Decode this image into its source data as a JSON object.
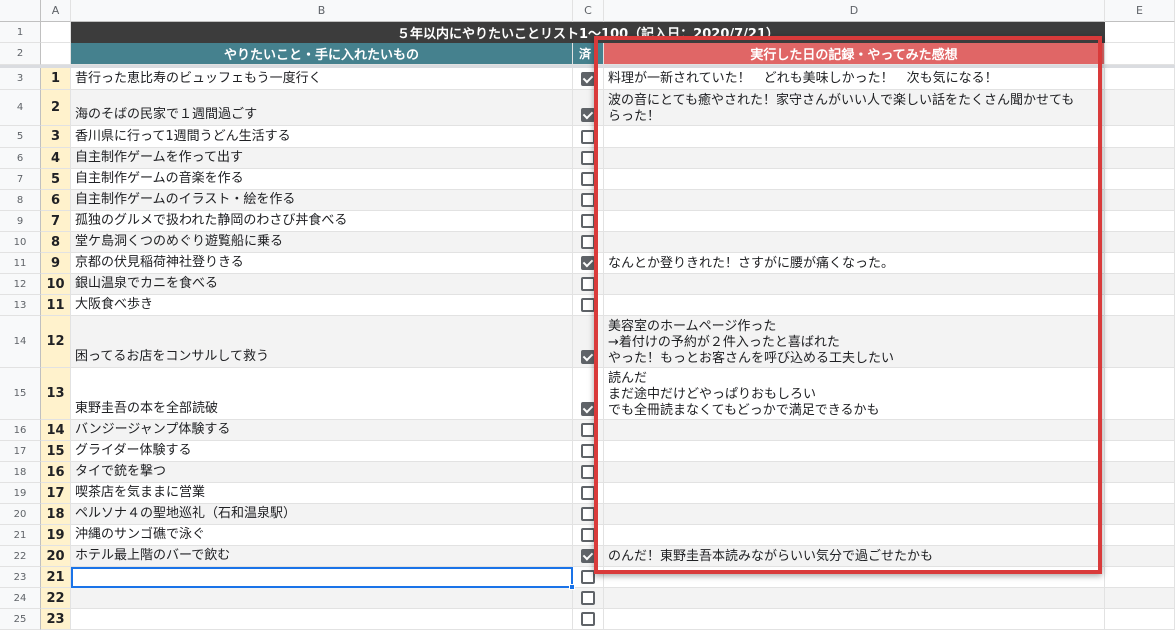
{
  "columns": {
    "row_header": "",
    "a": "A",
    "b": "B",
    "c": "C",
    "d": "D",
    "e": "E"
  },
  "title": "５年以内にやりたいことリスト1〜100（記入日：2020/7/21）",
  "headers": {
    "b": "やりたいこと・手に入れたいもの",
    "c": "済",
    "d": "実行した日の記録・やってみた感想"
  },
  "colors": {
    "title_bg": "#3c3c3c",
    "header_teal": "#45818e",
    "header_red": "#e06666",
    "number_bg": "#fff2cc",
    "highlight": "#d93a3a"
  },
  "rows": [
    {
      "rownum": "3",
      "n": "1",
      "item": "昔行った恵比寿のビュッフェもう一度行く",
      "done": true,
      "note": "料理が一新されていた！　どれも美味しかった！　次も気になる！"
    },
    {
      "rownum": "4",
      "n": "2",
      "item": "海のそばの民家で１週間過ごす",
      "done": true,
      "note": "波の音にとても癒やされた！家守さんがいい人で楽しい話をたくさん聞かせても\nらった！"
    },
    {
      "rownum": "5",
      "n": "3",
      "item": "香川県に行って1週間うどん生活する",
      "done": false,
      "note": ""
    },
    {
      "rownum": "6",
      "n": "4",
      "item": "自主制作ゲームを作って出す",
      "done": false,
      "note": ""
    },
    {
      "rownum": "7",
      "n": "5",
      "item": "自主制作ゲームの音楽を作る",
      "done": false,
      "note": ""
    },
    {
      "rownum": "8",
      "n": "6",
      "item": "自主制作ゲームのイラスト・絵を作る",
      "done": false,
      "note": ""
    },
    {
      "rownum": "9",
      "n": "7",
      "item": "孤独のグルメで扱われた静岡のわさび丼食べる",
      "done": false,
      "note": ""
    },
    {
      "rownum": "10",
      "n": "8",
      "item": "堂ケ島洞くつのめぐり遊覧船に乗る",
      "done": false,
      "note": ""
    },
    {
      "rownum": "11",
      "n": "9",
      "item": "京都の伏見稲荷神社登りきる",
      "done": true,
      "note": "なんとか登りきれた！さすがに腰が痛くなった。"
    },
    {
      "rownum": "12",
      "n": "10",
      "item": "銀山温泉でカニを食べる",
      "done": false,
      "note": ""
    },
    {
      "rownum": "13",
      "n": "11",
      "item": "大阪食べ歩き",
      "done": false,
      "note": ""
    },
    {
      "rownum": "14",
      "n": "12",
      "item": "困ってるお店をコンサルして救う",
      "done": true,
      "note": "美容室のホームページ作った\n→着付けの予約が２件入ったと喜ばれた\nやった！もっとお客さんを呼び込める工夫したい"
    },
    {
      "rownum": "15",
      "n": "13",
      "item": "東野圭吾の本を全部読破",
      "done": true,
      "note": "読んだ\nまだ途中だけどやっぱりおもしろい\nでも全冊読まなくてもどっかで満足できるかも"
    },
    {
      "rownum": "16",
      "n": "14",
      "item": "バンジージャンプ体験する",
      "done": false,
      "note": ""
    },
    {
      "rownum": "17",
      "n": "15",
      "item": "グライダー体験する",
      "done": false,
      "note": ""
    },
    {
      "rownum": "18",
      "n": "16",
      "item": "タイで銃を撃つ",
      "done": false,
      "note": ""
    },
    {
      "rownum": "19",
      "n": "17",
      "item": "喫茶店を気ままに営業",
      "done": false,
      "note": ""
    },
    {
      "rownum": "20",
      "n": "18",
      "item": "ペルソナ４の聖地巡礼（石和温泉駅）",
      "done": false,
      "note": ""
    },
    {
      "rownum": "21",
      "n": "19",
      "item": "沖縄のサンゴ礁で泳ぐ",
      "done": false,
      "note": ""
    },
    {
      "rownum": "22",
      "n": "20",
      "item": "ホテル最上階のバーで飲む",
      "done": true,
      "note": "のんだ！東野圭吾本読みながらいい気分で過ごせたかも"
    },
    {
      "rownum": "23",
      "n": "21",
      "item": "",
      "done": false,
      "note": ""
    },
    {
      "rownum": "24",
      "n": "22",
      "item": "",
      "done": false,
      "note": ""
    },
    {
      "rownum": "25",
      "n": "23",
      "item": "",
      "done": false,
      "note": ""
    }
  ]
}
